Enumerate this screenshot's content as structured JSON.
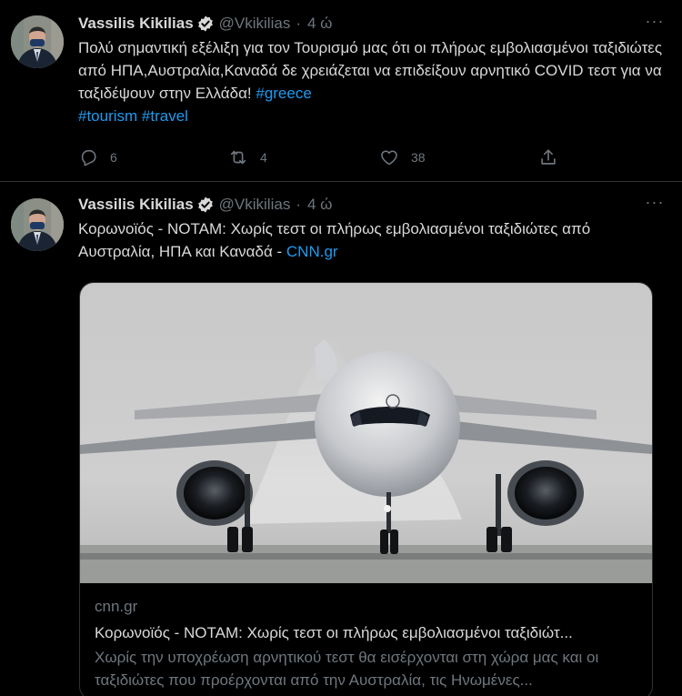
{
  "tweets": [
    {
      "author": "Vassilis Kikilias",
      "handle": "@Vkikilias",
      "time": "4 ώ",
      "more_label": "···",
      "text": "Πολύ σημαντική εξέλιξη για τον Τουρισμό μας ότι οι πλήρως εμβολιασμένοι ταξιδιώτες από ΗΠΑ,Αυστραλία,Καναδά δε χρειάζεται να επιδείξουν αρνητικό COVID τεστ για να ταξιδέψουν στην Ελλάδα! ",
      "hashtags": [
        "#greece",
        "#tourism",
        "#travel"
      ],
      "stats": {
        "replies": "6",
        "retweets": "4",
        "likes": "38"
      }
    },
    {
      "author": "Vassilis Kikilias",
      "handle": "@Vkikilias",
      "time": "4 ώ",
      "more_label": "···",
      "text": "Κορωνοϊός - NOTAM: Χωρίς τεστ οι πλήρως εμβολιασμένοι ταξιδιώτες από Αυστραλία, ΗΠΑ και Καναδά - ",
      "link_text": "CNN.gr",
      "card": {
        "domain": "cnn.gr",
        "title": "Κορωνοϊός - NOTAM: Χωρίς τεστ οι πλήρως εμβολιασμένοι ταξιδιώτ...",
        "description": "Χωρίς την υποχρέωση αρνητικού τεστ θα εισέρχονται στη χώρα μας και οι ταξιδιώτες που προέρχονται από την Αυστραλία, τις Ηνωμένες..."
      }
    }
  ],
  "icons": {
    "verified": "verified-badge-icon",
    "reply": "reply-icon",
    "retweet": "retweet-icon",
    "like": "heart-icon",
    "share": "share-icon"
  },
  "colors": {
    "background": "#000000",
    "text": "#d9d9d9",
    "muted": "#6e767d",
    "link": "#1d9bf0",
    "border": "#2f3336"
  }
}
